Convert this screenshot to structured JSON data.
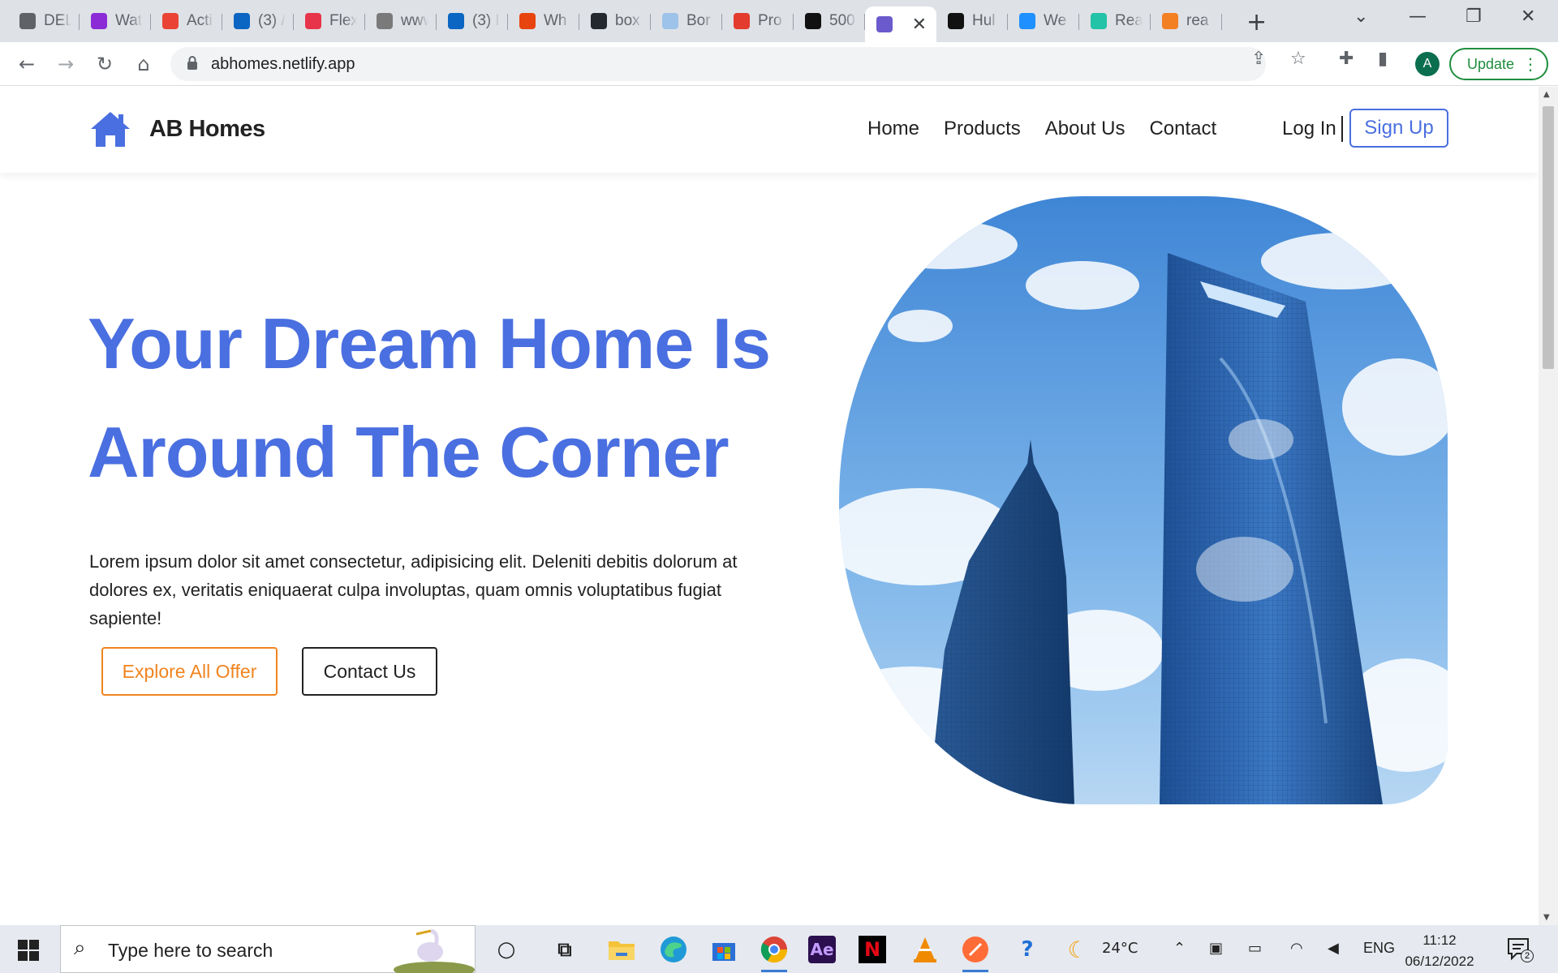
{
  "browser": {
    "tabs": [
      {
        "title": "DEL",
        "icon": "globe-icon",
        "color": "#5f6368"
      },
      {
        "title": "Wat",
        "icon": "play-icon",
        "color": "#8b2cd6"
      },
      {
        "title": "Acti",
        "icon": "gmail-icon",
        "color": "#ea4335"
      },
      {
        "title": "(3) /",
        "icon": "linkedin-icon",
        "color": "#0a66c2"
      },
      {
        "title": "Flex",
        "icon": "flex-icon",
        "color": "#e8344a"
      },
      {
        "title": "www",
        "icon": "linkedin-gray-icon",
        "color": "#7a7a7a"
      },
      {
        "title": "(3) I",
        "icon": "linkedin-icon",
        "color": "#0a66c2"
      },
      {
        "title": "Wh",
        "icon": "alert-icon",
        "color": "#e8440f"
      },
      {
        "title": "box",
        "icon": "github-icon",
        "color": "#24292f"
      },
      {
        "title": "Bor",
        "icon": "loading-icon",
        "color": "#9ec3ea"
      },
      {
        "title": "Pro",
        "icon": "bars-icon",
        "color": "#e33b2e"
      },
      {
        "title": "500",
        "icon": "unsplash-icon",
        "color": "#111111"
      },
      {
        "title": "",
        "icon": "netlify-icon",
        "color": "#6b5acd",
        "active": true
      },
      {
        "title": "Hul",
        "icon": "hulu-icon",
        "color": "#111111"
      },
      {
        "title": "We",
        "icon": "weather-icon",
        "color": "#1e90ff"
      },
      {
        "title": "Rea",
        "icon": "react-icon",
        "color": "#22c3a6"
      },
      {
        "title": "rea",
        "icon": "stackoverflow-icon",
        "color": "#f48024"
      }
    ],
    "url": "abhomes.netlify.app",
    "profile_initial": "A",
    "update_label": "Update"
  },
  "site": {
    "brand": "AB Homes",
    "nav": [
      "Home",
      "Products",
      "About Us",
      "Contact"
    ],
    "login_label": "Log In",
    "signup_label": "Sign Up",
    "hero_title_line1": "Your Dream Home Is",
    "hero_title_line2": "Around The Corner",
    "hero_text": "Lorem ipsum dolor sit amet consectetur, adipisicing elit. Deleniti debitis dolorum at dolores ex, veritatis eniquaerat culpa involuptas, quam omnis voluptatibus fugiat sapiente!",
    "explore_label": "Explore All Offer",
    "contact_label": "Contact Us",
    "accent_color": "#4a6fe0",
    "orange_color": "#f0841f"
  },
  "taskbar": {
    "search_placeholder": "Type here to search",
    "temperature": "24°C",
    "language": "ENG",
    "time": "11:12",
    "date": "06/12/2022",
    "notification_count": "2"
  }
}
